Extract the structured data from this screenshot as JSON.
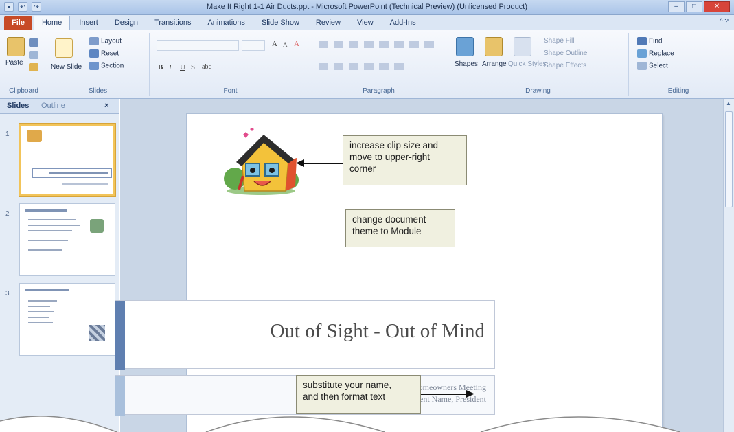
{
  "window": {
    "title": "Make It Right 1-1 Air Ducts.ppt - Microsoft PowerPoint (Technical Preview) (Unlicensed Product)",
    "minimize": "–",
    "maximize": "□",
    "close": "✕"
  },
  "qat": {
    "save": "▪",
    "undo": "↶",
    "redo": "↷"
  },
  "ribbon": {
    "tabs": [
      {
        "label": "File"
      },
      {
        "label": "Home"
      },
      {
        "label": "Insert"
      },
      {
        "label": "Design"
      },
      {
        "label": "Transitions"
      },
      {
        "label": "Animations"
      },
      {
        "label": "Slide Show"
      },
      {
        "label": "Review"
      },
      {
        "label": "View"
      },
      {
        "label": "Add-Ins"
      }
    ],
    "help": "^ ?",
    "clipboard": {
      "label": "Clipboard",
      "paste": "Paste"
    },
    "slides": {
      "label": "Slides",
      "new_slide": "New Slide",
      "layout": "Layout",
      "reset": "Reset",
      "section": "Section"
    },
    "font": {
      "label": "Font",
      "bold": "B",
      "italic": "I",
      "underline": "U",
      "shadow": "S",
      "strike": "abc",
      "grow": "A",
      "shrink": "A",
      "clear": "A"
    },
    "paragraph": {
      "label": "Paragraph"
    },
    "drawing": {
      "label": "Drawing",
      "shapes": "Shapes",
      "arrange": "Arrange",
      "quick_styles": "Quick Styles",
      "shape_fill": "Shape Fill",
      "shape_outline": "Shape Outline",
      "shape_effects": "Shape Effects"
    },
    "editing": {
      "label": "Editing",
      "find": "Find",
      "replace": "Replace",
      "select": "Select"
    }
  },
  "panel": {
    "tabs": {
      "slides": "Slides",
      "outline": "Outline",
      "close": "×"
    },
    "thumbnails": [
      {
        "num": "1",
        "title": "Out of Sight - Out of Mind"
      },
      {
        "num": "2",
        "title": "Air Duct Cleaning"
      },
      {
        "num": "3",
        "title": "Duct Cleaning Process"
      }
    ]
  },
  "slide": {
    "title": "Out of Sight - Out of Mind",
    "subtitle_lines": [
      "Hickory Bend Homeowners Meeting",
      "Student Name, President"
    ]
  },
  "callouts": {
    "clip": [
      "increase clip size and",
      "move to upper-right",
      "corner"
    ],
    "theme": [
      "change document",
      "theme to Module"
    ],
    "name": [
      "substitute your name,",
      "and then format text"
    ]
  }
}
